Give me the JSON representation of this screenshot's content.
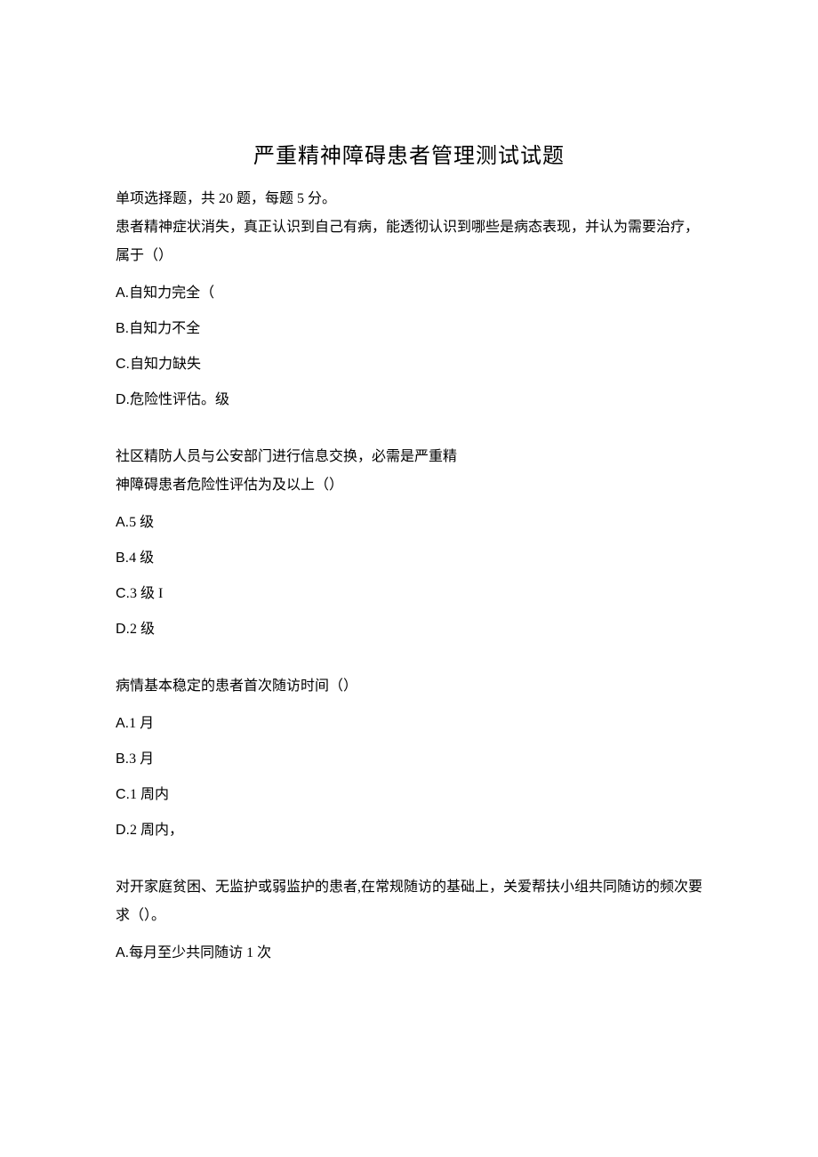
{
  "title": "严重精神障碍患者管理测试试题",
  "instructions": "单项选择题，共 20 题，每题 5 分。",
  "questions": [
    {
      "text": "患者精神症状消失，真正认识到自己有病，能透彻认识到哪些是病态表现，并认为需要治疗，属于（）",
      "options": [
        {
          "label": "A.",
          "text": "自知力完全（"
        },
        {
          "label": "B.",
          "text": "自知力不全"
        },
        {
          "label": "C.",
          "text": "自知力缺失"
        },
        {
          "label": "D.",
          "text": "危险性评估。级"
        }
      ]
    },
    {
      "text_lines": [
        "社区精防人员与公安部门进行信息交换，必需是严重精",
        "神障碍患者危险性评估为及以上（）"
      ],
      "options": [
        {
          "label": "A.",
          "text": "5 级"
        },
        {
          "label": "B.",
          "text": "4 级"
        },
        {
          "label": "C.",
          "text": "3 级 I"
        },
        {
          "label": "D.",
          "text": "2 级"
        }
      ]
    },
    {
      "text": "病情基本稳定的患者首次随访时间（）",
      "options": [
        {
          "label": "A.",
          "text": "1 月"
        },
        {
          "label": "B.",
          "text": "3 月"
        },
        {
          "label": "C.",
          "text": "1 周内"
        },
        {
          "label": "D.",
          "text": "2 周内，"
        }
      ]
    },
    {
      "text": "对开家庭贫困、无监护或弱监护的患者,在常规随访的基础上，关爱帮扶小组共同随访的频次要求（）。",
      "options": [
        {
          "label": "A.",
          "text": "每月至少共同随访 1 次"
        }
      ]
    }
  ]
}
